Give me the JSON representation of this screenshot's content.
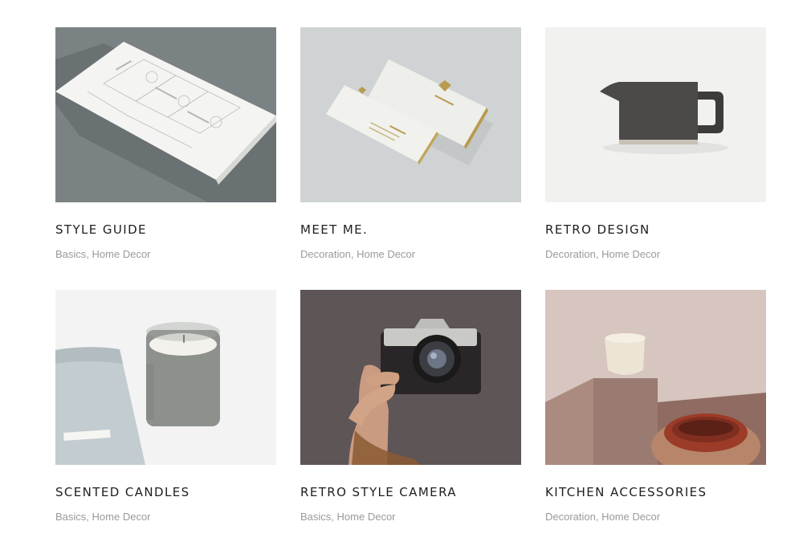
{
  "portfolio": {
    "items": [
      {
        "title": "STYLE GUIDE",
        "categories": [
          "Basics",
          "Home Decor"
        ],
        "image": "style-guide-print-image"
      },
      {
        "title": "MEET ME.",
        "categories": [
          "Decoration",
          "Home Decor"
        ],
        "image": "business-card-image"
      },
      {
        "title": "RETRO DESIGN",
        "categories": [
          "Decoration",
          "Home Decor"
        ],
        "image": "pitcher-image"
      },
      {
        "title": "SCENTED CANDLES",
        "categories": [
          "Basics",
          "Home Decor"
        ],
        "image": "candle-image"
      },
      {
        "title": "RETRO STYLE CAMERA",
        "categories": [
          "Basics",
          "Home Decor"
        ],
        "image": "camera-image"
      },
      {
        "title": "KITCHEN ACCESSORIES",
        "categories": [
          "Decoration",
          "Home Decor"
        ],
        "image": "kitchen-bowls-image"
      }
    ],
    "separator": ", "
  },
  "colors": {
    "title": "#1f1f1f",
    "category": "#9a9a9a"
  }
}
